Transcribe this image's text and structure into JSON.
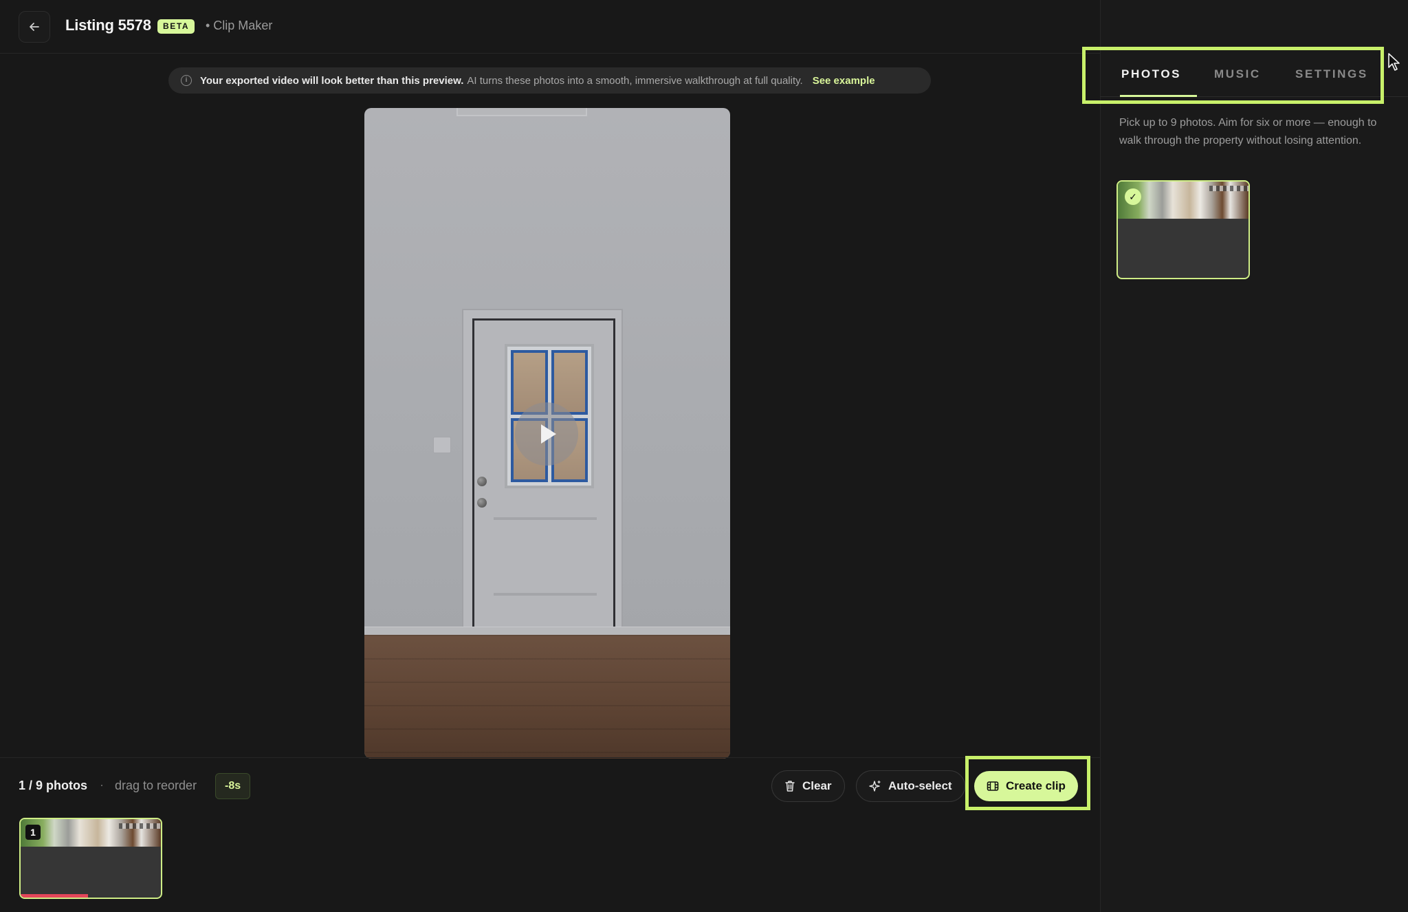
{
  "header": {
    "title": "Listing 5578",
    "badge": "BETA",
    "crumb": "• Clip Maker"
  },
  "banner": {
    "strong": "Your exported video will look better than this preview.",
    "text": "AI turns these photos into a smooth, immersive walkthrough at full quality.",
    "link": "See example"
  },
  "bottom": {
    "count": "1 / 9 photos",
    "separator": "·",
    "drag_hint": "drag to reorder",
    "duration": "-8s",
    "clear_label": "Clear",
    "auto_label": "Auto-select",
    "create_label": "Create clip"
  },
  "strip": {
    "items": [
      {
        "index": "1",
        "progress": 0.48
      }
    ]
  },
  "panel": {
    "tabs": [
      {
        "label": "PHOTOS",
        "active": true
      },
      {
        "label": "MUSIC",
        "active": false
      },
      {
        "label": "SETTINGS",
        "active": false
      }
    ],
    "hint": "Pick up to 9 photos. Aim for six or more — enough to walk through the property without losing attention.",
    "photos": [
      {
        "selected": true
      }
    ]
  },
  "colors": {
    "accent": "#d7f79a",
    "highlight": "#c8f06a",
    "progress": "#e4465a",
    "background": "#181818"
  },
  "icons": {
    "back": "arrow-left-icon",
    "info": "info-icon",
    "play": "play-icon",
    "clear": "trash-icon",
    "auto": "sparkle-icon",
    "create": "film-icon",
    "check": "check-icon",
    "cursor": "mouse-pointer-icon"
  }
}
